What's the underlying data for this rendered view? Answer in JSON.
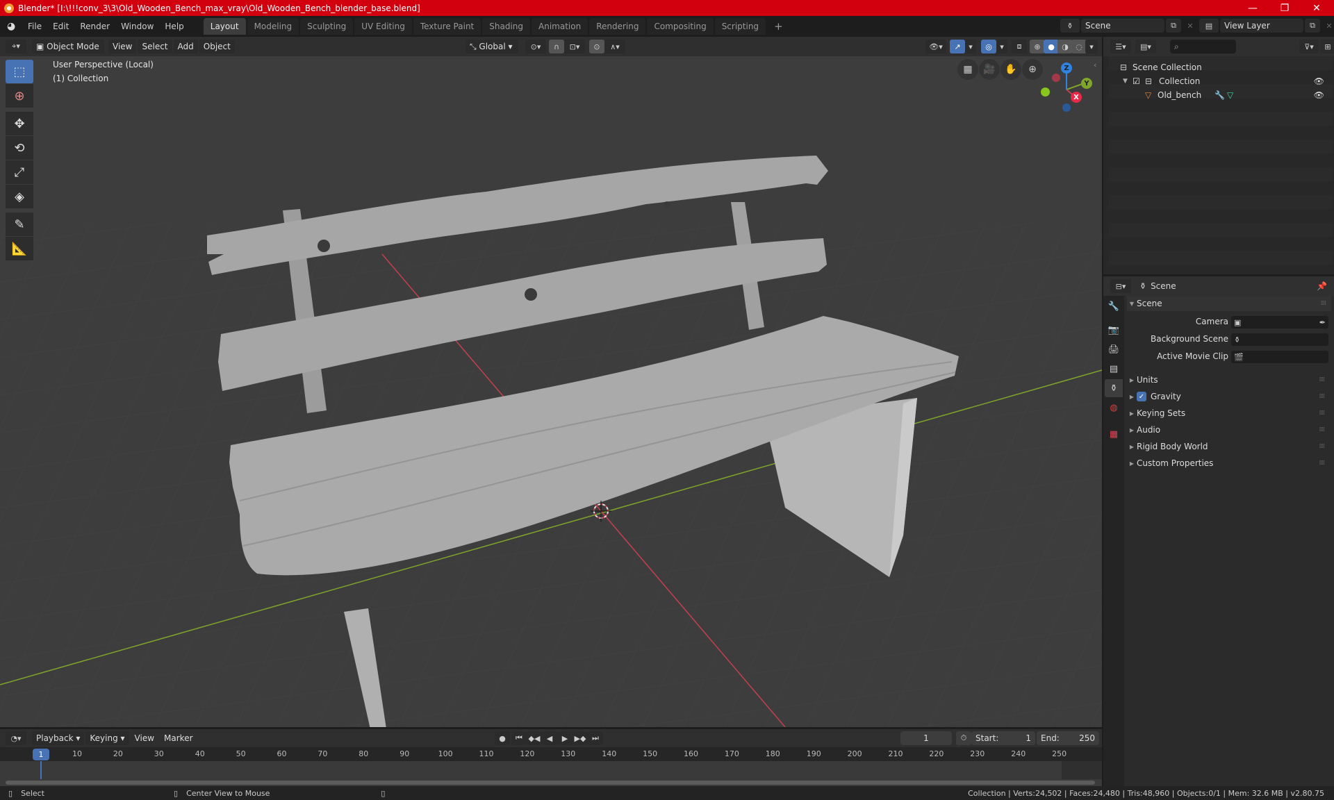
{
  "window": {
    "title": "Blender* [I:\\!!!conv_3\\3\\Old_Wooden_Bench_max_vray\\Old_Wooden_Bench_blender_base.blend]",
    "controls": {
      "minimize": "—",
      "maximize": "❐",
      "close": "✕"
    }
  },
  "menu": {
    "items": [
      "File",
      "Edit",
      "Render",
      "Window",
      "Help"
    ],
    "workspaces": [
      "Layout",
      "Modeling",
      "Sculpting",
      "UV Editing",
      "Texture Paint",
      "Shading",
      "Animation",
      "Rendering",
      "Compositing",
      "Scripting"
    ],
    "active_workspace": "Layout",
    "add_workspace": "+",
    "scene": "Scene",
    "view_layer": "View Layer"
  },
  "viewport_header": {
    "mode": "Object Mode",
    "menus": [
      "View",
      "Select",
      "Add",
      "Object"
    ],
    "transform_orientation": "Global"
  },
  "viewport": {
    "perspective": "User Perspective (Local)",
    "collection": "(1) Collection",
    "gizmo": {
      "z": "Z",
      "y": "Y",
      "x": "X"
    },
    "colors": {
      "x_axis": "#c4404f",
      "y_axis": "#7fa52a",
      "z_axis": "#2f84e3",
      "grid": "#484848",
      "background": "#3d3d3d",
      "mesh": "#a3a3a3"
    }
  },
  "toolbar": {
    "tools": [
      "select-box",
      "cursor",
      "move",
      "rotate",
      "scale",
      "transform",
      "annotate",
      "measure"
    ]
  },
  "outliner": {
    "search_placeholder": "",
    "root": "Scene Collection",
    "collection": "Collection",
    "object": "Old_bench"
  },
  "properties": {
    "header": "Scene",
    "section": "Scene",
    "fields": [
      {
        "label": "Camera",
        "value": ""
      },
      {
        "label": "Background Scene",
        "value": ""
      },
      {
        "label": "Active Movie Clip",
        "value": ""
      }
    ],
    "panels": [
      "Units",
      "Gravity",
      "Keying Sets",
      "Audio",
      "Rigid Body World",
      "Custom Properties"
    ],
    "gravity_enabled": true
  },
  "timeline": {
    "menus": [
      "Playback",
      "Keying",
      "View",
      "Marker"
    ],
    "current_frame": "1",
    "start_label": "Start:",
    "start": "1",
    "end_label": "End:",
    "end": "250",
    "ticks": [
      "10",
      "20",
      "30",
      "40",
      "50",
      "60",
      "70",
      "80",
      "90",
      "100",
      "110",
      "120",
      "130",
      "140",
      "150",
      "160",
      "170",
      "180",
      "190",
      "200",
      "210",
      "220",
      "230",
      "240",
      "250"
    ],
    "playhead": "1"
  },
  "statusbar": {
    "left_action": "Select",
    "middle_action": "Center View to Mouse",
    "stats": "Collection | Verts:24,502 | Faces:24,480 | Tris:48,960 | Objects:0/1 | Mem: 32.6 MB | v2.80.75"
  }
}
